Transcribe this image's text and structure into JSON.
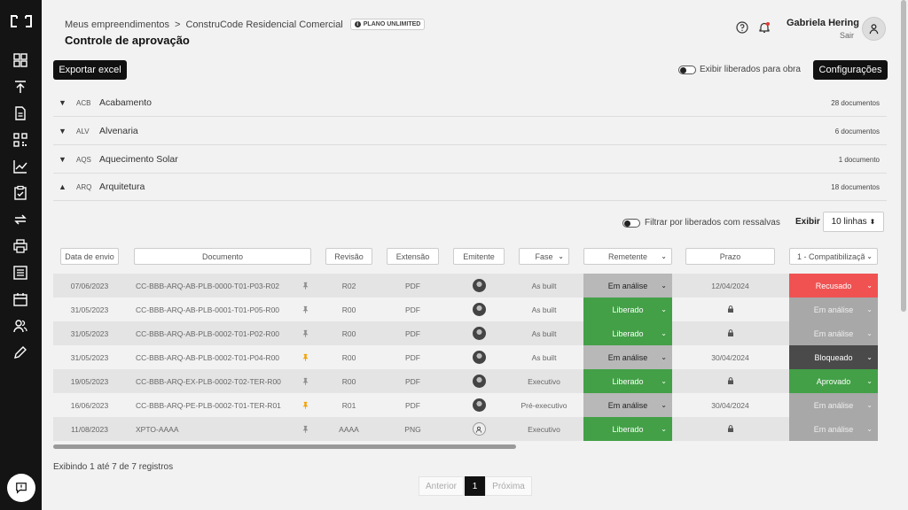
{
  "colors": {
    "sidebar": "#141414",
    "liberado": "#43a047",
    "recusado": "#f05252",
    "em_analise_active": "#b8b8b8",
    "em_analise_disabled": "#a8a8a8",
    "bloqueado": "#4a4a4a",
    "aprovado": "#43a047",
    "pin_active": "#f3a000",
    "pin_inactive": "#8d8d8d"
  },
  "sidebar": {
    "logo_icon": "brand-logo-icon",
    "items": [
      {
        "name": "dashboard-icon"
      },
      {
        "name": "upload-icon"
      },
      {
        "name": "document-icon"
      },
      {
        "name": "qrcode-icon"
      },
      {
        "name": "chart-icon"
      },
      {
        "name": "clipboard-check-icon"
      },
      {
        "name": "approval-cycle-icon"
      },
      {
        "name": "printer-icon"
      },
      {
        "name": "list-icon"
      },
      {
        "name": "calendar-icon"
      },
      {
        "name": "users-icon"
      },
      {
        "name": "pencil-icon"
      }
    ],
    "chat_icon": "chat-alert-icon"
  },
  "header": {
    "breadcrumb_root": "Meus empreendimentos",
    "breadcrumb_sep": ">",
    "breadcrumb_project": "ConstruCode Residencial Comercial",
    "plan_badge": "PLANO UNLIMITED",
    "title": "Controle de aprovação",
    "user_name": "Gabriela Hering",
    "logout": "Sair"
  },
  "toolbar": {
    "export_label": "Exportar excel",
    "toggle_liberados_label": "Exibir liberados para obra",
    "config_label": "Configurações"
  },
  "groups": [
    {
      "code": "ACB",
      "name": "Acabamento",
      "count": "28 documentos",
      "expanded": false
    },
    {
      "code": "ALV",
      "name": "Alvenaria",
      "count": "6 documentos",
      "expanded": false
    },
    {
      "code": "AQS",
      "name": "Aquecimento Solar",
      "count": "1 documento",
      "expanded": false
    },
    {
      "code": "ARQ",
      "name": "Arquitetura",
      "count": "18 documentos",
      "expanded": true
    }
  ],
  "table": {
    "toggle_ressalvas_label": "Filtrar por liberados com ressalvas",
    "exibir_label": "Exibir",
    "rows_select": "10 linhas",
    "filters": {
      "data_envio": "Data de envio",
      "documento": "Documento",
      "revisao": "Revisão",
      "extensao": "Extensão",
      "emitente": "Emitente",
      "fase": "Fase",
      "remetente": "Remetente",
      "prazo": "Prazo",
      "etapa": "1 - Compatibilização"
    },
    "rows": [
      {
        "date": "07/06/2023",
        "doc": "CC-BBB-ARQ-AB-PLB-0000-T01-P03-R02",
        "pin": false,
        "rev": "R02",
        "ext": "PDF",
        "fase": "As built",
        "remetente": "Em análise",
        "remetente_status": "em_analise_active",
        "prazo": "12/04/2024",
        "etapa": "Recusado",
        "etapa_status": "recusado",
        "emit_photo": true
      },
      {
        "date": "31/05/2023",
        "doc": "CC-BBB-ARQ-AB-PLB-0001-T01-P05-R00",
        "pin": false,
        "rev": "R00",
        "ext": "PDF",
        "fase": "As built",
        "remetente": "Liberado",
        "remetente_status": "liberado",
        "prazo": "",
        "etapa": "Em análise",
        "etapa_status": "em_analise_disabled",
        "emit_photo": true
      },
      {
        "date": "31/05/2023",
        "doc": "CC-BBB-ARQ-AB-PLB-0002-T01-P02-R00",
        "pin": false,
        "rev": "R00",
        "ext": "PDF",
        "fase": "As built",
        "remetente": "Liberado",
        "remetente_status": "liberado",
        "prazo": "",
        "etapa": "Em análise",
        "etapa_status": "em_analise_disabled",
        "emit_photo": true
      },
      {
        "date": "31/05/2023",
        "doc": "CC-BBB-ARQ-AB-PLB-0002-T01-P04-R00",
        "pin": true,
        "rev": "R00",
        "ext": "PDF",
        "fase": "As built",
        "remetente": "Em análise",
        "remetente_status": "em_analise_active",
        "prazo": "30/04/2024",
        "etapa": "Bloqueado",
        "etapa_status": "bloqueado",
        "emit_photo": true
      },
      {
        "date": "19/05/2023",
        "doc": "CC-BBB-ARQ-EX-PLB-0002-T02-TER-R00",
        "pin": false,
        "rev": "R00",
        "ext": "PDF",
        "fase": "Executivo",
        "remetente": "Liberado",
        "remetente_status": "liberado",
        "prazo": "",
        "etapa": "Aprovado",
        "etapa_status": "aprovado",
        "emit_photo": true
      },
      {
        "date": "16/06/2023",
        "doc": "CC-BBB-ARQ-PE-PLB-0002-T01-TER-R01",
        "pin": true,
        "rev": "R01",
        "ext": "PDF",
        "fase": "Pré-executivo",
        "remetente": "Em análise",
        "remetente_status": "em_analise_active",
        "prazo": "30/04/2024",
        "etapa": "Em análise",
        "etapa_status": "em_analise_disabled",
        "emit_photo": true
      },
      {
        "date": "11/08/2023",
        "doc": "XPTO-AAAA",
        "pin": false,
        "rev": "AAAA",
        "ext": "PNG",
        "fase": "Executivo",
        "remetente": "Liberado",
        "remetente_status": "liberado",
        "prazo": "",
        "etapa": "Em análise",
        "etapa_status": "em_analise_disabled",
        "emit_photo": false
      }
    ]
  },
  "footer": {
    "showing": "Exibindo 1 até 7 de 7 registros",
    "prev": "Anterior",
    "current_page": "1",
    "next": "Próxima"
  }
}
